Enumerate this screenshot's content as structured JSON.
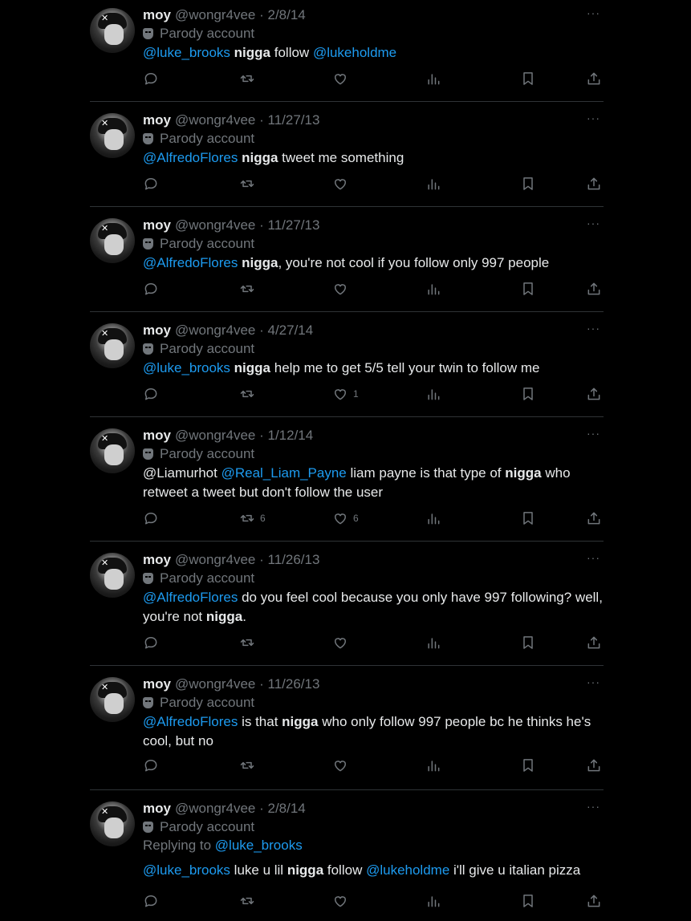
{
  "tweets": [
    {
      "name": "moy",
      "handle": "@wongr4vee · 2/8/14",
      "parody": "Parody account",
      "segments": [
        {
          "t": "@luke_brooks",
          "c": "mention"
        },
        {
          "t": " "
        },
        {
          "t": "nigga",
          "c": "bold"
        },
        {
          "t": " follow "
        },
        {
          "t": "@lukeholdme",
          "c": "mention"
        }
      ],
      "retweets": "",
      "likes": ""
    },
    {
      "name": "moy",
      "handle": "@wongr4vee · 11/27/13",
      "parody": "Parody account",
      "segments": [
        {
          "t": "@AlfredoFlores",
          "c": "mention"
        },
        {
          "t": " "
        },
        {
          "t": "nigga",
          "c": "bold"
        },
        {
          "t": " tweet me something"
        }
      ],
      "retweets": "",
      "likes": ""
    },
    {
      "name": "moy",
      "handle": "@wongr4vee · 11/27/13",
      "parody": "Parody account",
      "segments": [
        {
          "t": "@AlfredoFlores",
          "c": "mention"
        },
        {
          "t": " "
        },
        {
          "t": "nigga",
          "c": "bold"
        },
        {
          "t": ", you're not cool if you follow only 997 people"
        }
      ],
      "retweets": "",
      "likes": ""
    },
    {
      "name": "moy",
      "handle": "@wongr4vee · 4/27/14",
      "parody": "Parody account",
      "segments": [
        {
          "t": "@luke_brooks",
          "c": "mention"
        },
        {
          "t": " "
        },
        {
          "t": "nigga",
          "c": "bold"
        },
        {
          "t": " help me to get 5/5 tell your twin to follow me"
        }
      ],
      "retweets": "",
      "likes": "1"
    },
    {
      "name": "moy",
      "handle": "@wongr4vee · 1/12/14",
      "parody": "Parody account",
      "segments": [
        {
          "t": "@Liamurhot "
        },
        {
          "t": "@Real_Liam_Payne",
          "c": "mention"
        },
        {
          "t": " liam payne is that type of "
        },
        {
          "t": "nigga",
          "c": "bold"
        },
        {
          "t": " who retweet a tweet but don't follow the user"
        }
      ],
      "retweets": "6",
      "likes": "6"
    },
    {
      "name": "moy",
      "handle": "@wongr4vee · 11/26/13",
      "parody": "Parody account",
      "segments": [
        {
          "t": "@AlfredoFlores",
          "c": "mention"
        },
        {
          "t": " do you feel cool because you only have 997 following? well, you're not "
        },
        {
          "t": "nigga",
          "c": "bold"
        },
        {
          "t": "."
        }
      ],
      "retweets": "",
      "likes": ""
    },
    {
      "name": "moy",
      "handle": "@wongr4vee · 11/26/13",
      "parody": "Parody account",
      "segments": [
        {
          "t": "@AlfredoFlores",
          "c": "mention"
        },
        {
          "t": " is that "
        },
        {
          "t": "nigga",
          "c": "bold"
        },
        {
          "t": " who only follow 997 people bc he thinks he's cool, but no"
        }
      ],
      "retweets": "",
      "likes": ""
    },
    {
      "name": "moy",
      "handle": "@wongr4vee · 2/8/14",
      "parody": "Parody account",
      "replying_label": "Replying to ",
      "replying_handle": "@luke_brooks",
      "segments": [
        {
          "t": "@luke_brooks",
          "c": "mention"
        },
        {
          "t": " luke u lil "
        },
        {
          "t": "nigga",
          "c": "bold"
        },
        {
          "t": " follow "
        },
        {
          "t": "@lukeholdme",
          "c": "mention"
        },
        {
          "t": " i'll give u italian pizza"
        }
      ],
      "retweets": "",
      "likes": ""
    }
  ],
  "more_label": "···",
  "icons": [
    "reply-icon",
    "retweet-icon",
    "like-icon",
    "views-icon",
    "bookmark-icon",
    "share-icon"
  ],
  "colors": {
    "background": "#000000",
    "text": "#e7e9ea",
    "muted": "#71767b",
    "mention": "#1d9bf0",
    "divider": "#2f3336"
  }
}
